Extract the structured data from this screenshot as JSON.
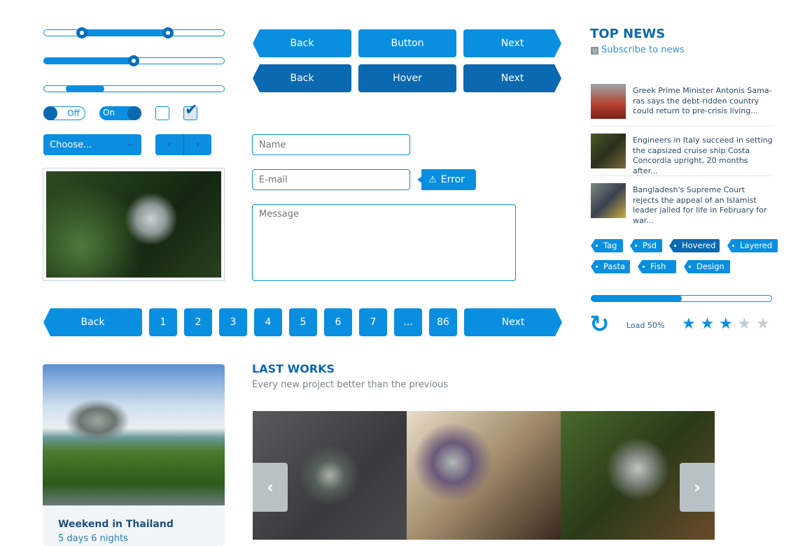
{
  "sliders": {
    "range": {
      "low": 21,
      "high": 69
    },
    "single": {
      "value": 50
    },
    "scroll": {
      "start": 12,
      "end": 33
    }
  },
  "toggles": {
    "off_label": "Off",
    "on_label": "On"
  },
  "checkboxes": [
    {
      "checked": false
    },
    {
      "checked": true
    }
  ],
  "dropdown": {
    "value": "Choose..."
  },
  "buttons": {
    "row1": [
      "Back",
      "Button",
      "Next"
    ],
    "row2": [
      "Back",
      "Hover",
      "Next"
    ]
  },
  "form": {
    "name_placeholder": "Name",
    "email_placeholder": "E-mail",
    "error_label": "Error",
    "message_placeholder": "Message"
  },
  "pagination": {
    "back": "Back",
    "pages": [
      "1",
      "2",
      "3",
      "4",
      "5",
      "6",
      "7",
      "...",
      "86"
    ],
    "next": "Next"
  },
  "top_news": {
    "title": "TOP NEWS",
    "subscribe": "Subscribe to news",
    "items": [
      "Greek Prime Minister Antonis Sama-ras says the debt-ridden country could return to pre-crisis living...",
      "Engineers in Italy succeed in setting the capsized cruise ship Costa Concordia upright, 20 months after...",
      "Bangladesh's Supreme Court rejects the appeal of an Islamist leader jailed for life in February for war..."
    ]
  },
  "tags": [
    {
      "label": "Tag"
    },
    {
      "label": "Psd"
    },
    {
      "label": "Hovered",
      "hovered": true
    },
    {
      "label": "Layered"
    },
    {
      "label": "Pasta"
    },
    {
      "label": "Fish"
    },
    {
      "label": "Design"
    }
  ],
  "progress": {
    "percent": 50,
    "label": "Load 50%"
  },
  "rating": {
    "value": 3,
    "max": 5
  },
  "card": {
    "title": "Weekend in Thailand",
    "subtitle": "5 days 6 nights"
  },
  "last_works": {
    "title": "LAST WORKS",
    "subtitle": "Every new project better than the previous"
  },
  "colors": {
    "primary": "#0a8fe0",
    "dark": "#0a69b0",
    "star_off": "#c5ccd1"
  }
}
